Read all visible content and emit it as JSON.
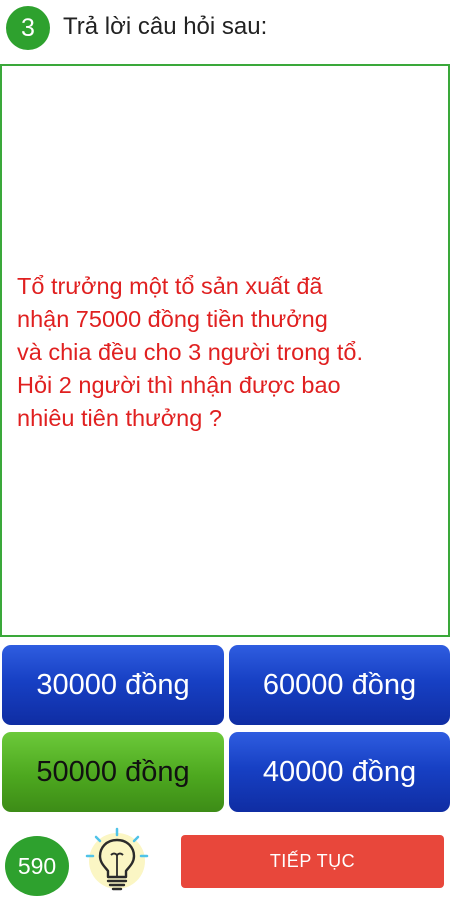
{
  "header": {
    "question_number": "3",
    "title": "Trả lời câu hỏi sau:"
  },
  "question": {
    "text": "Tổ trưởng một tổ sản xuất đã\nnhận 75000 đồng tiền  thưởng\nvà chia đều cho 3 người trong tổ.\nHỏi 2 người thì nhận được bao\nnhiêu tiên thưởng ?"
  },
  "answers": [
    {
      "label": "30000 đồng",
      "state": "default"
    },
    {
      "label": "60000 đồng",
      "state": "default"
    },
    {
      "label": "50000 đồng",
      "state": "selected"
    },
    {
      "label": "40000 đồng",
      "state": "default"
    }
  ],
  "footer": {
    "score": "590",
    "hint_icon": "lightbulb-icon",
    "continue_label": "TIẾP TỤC"
  },
  "colors": {
    "accent_green": "#2ea12e",
    "question_red": "#e02020",
    "answer_blue": "#1740c4",
    "answer_selected_green": "#4da81f",
    "continue_red": "#e8473b"
  }
}
